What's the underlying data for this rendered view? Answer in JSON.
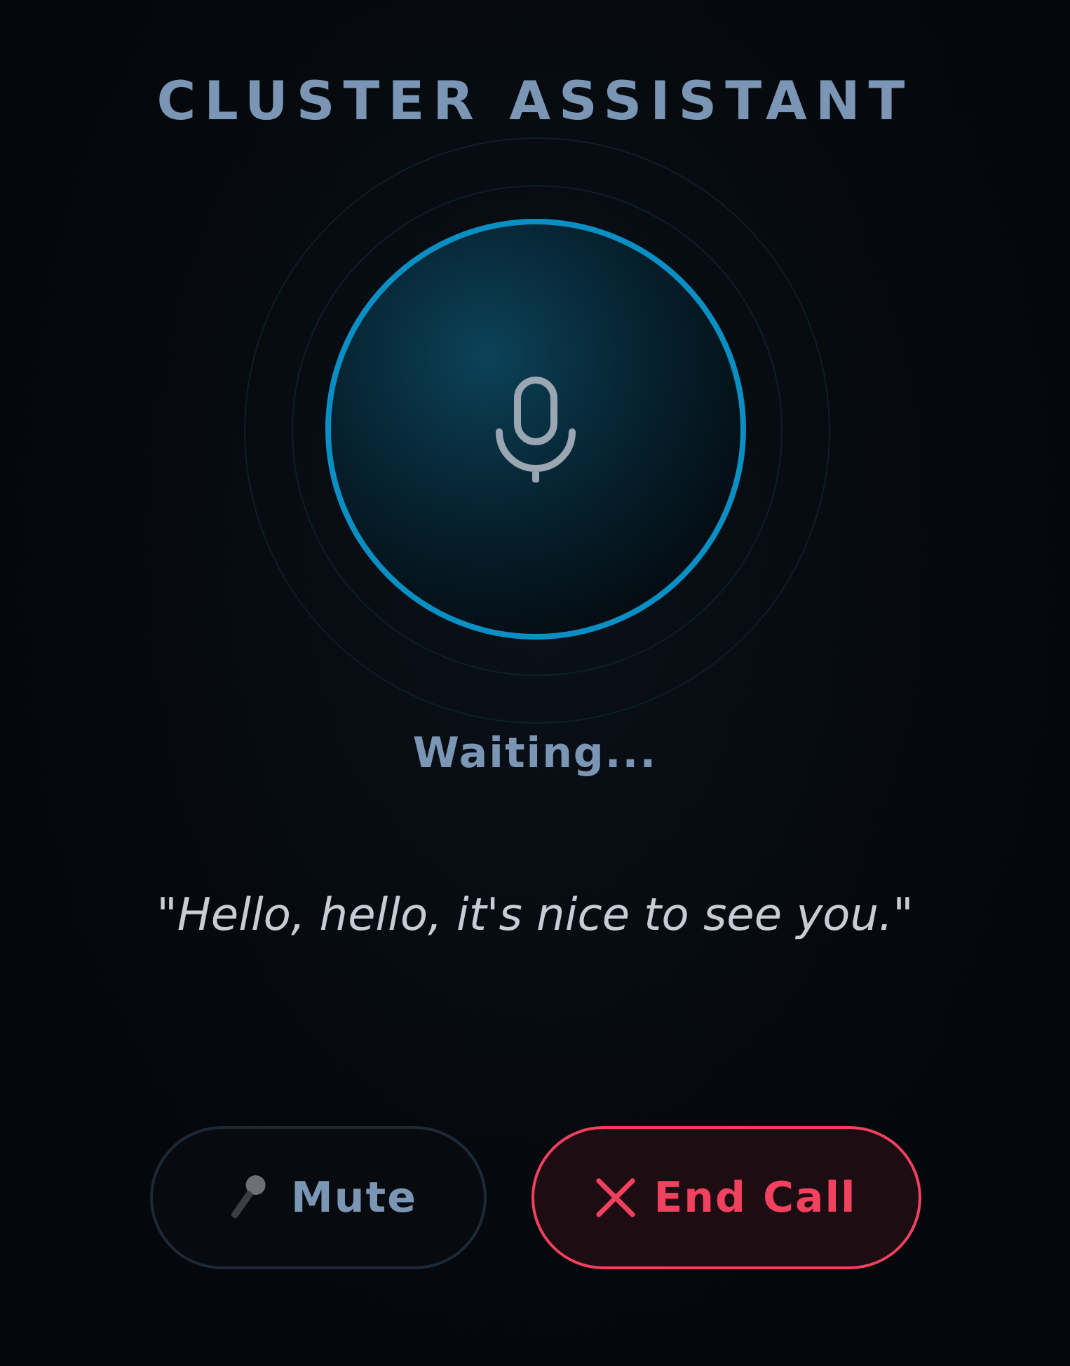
{
  "title": "CLUSTER ASSISTANT",
  "status": "Waiting...",
  "quote": "\"Hello, hello, it's nice to see you.\"",
  "buttons": [
    {
      "label": "Mute",
      "kind": "mute"
    },
    {
      "label": "End Call",
      "kind": "end"
    }
  ]
}
